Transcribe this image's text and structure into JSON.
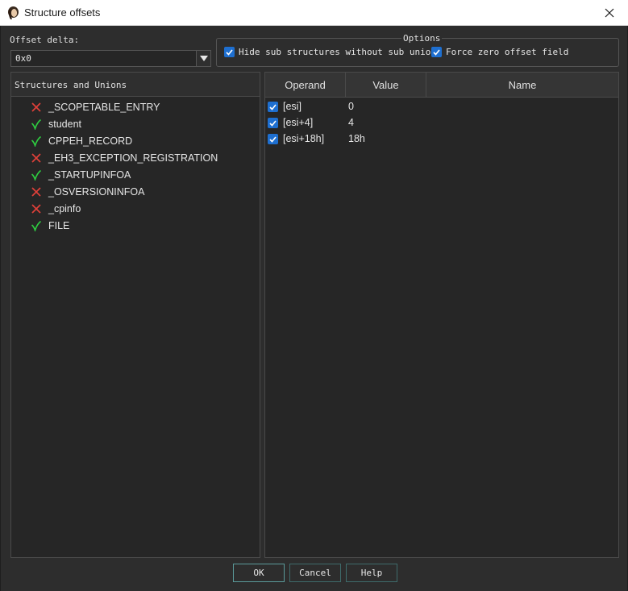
{
  "window": {
    "title": "Structure offsets",
    "icon": "app-icon",
    "close": "close-icon"
  },
  "offset": {
    "label": "Offset delta:",
    "value": "0x0"
  },
  "options": {
    "title": "Options",
    "hide_sub_structures": {
      "label": "Hide sub structures without sub unions",
      "checked": true
    },
    "force_zero_offset": {
      "label": "Force zero offset field",
      "checked": true
    }
  },
  "structures": {
    "header": "Structures and Unions",
    "items": [
      {
        "name": "_SCOPETABLE_ENTRY",
        "status": "invalid"
      },
      {
        "name": "student",
        "status": "valid"
      },
      {
        "name": "CPPEH_RECORD",
        "status": "valid"
      },
      {
        "name": "_EH3_EXCEPTION_REGISTRATION",
        "status": "invalid"
      },
      {
        "name": "_STARTUPINFOA",
        "status": "valid"
      },
      {
        "name": "_OSVERSIONINFOA",
        "status": "invalid"
      },
      {
        "name": "_cpinfo",
        "status": "invalid"
      },
      {
        "name": "FILE",
        "status": "valid"
      }
    ]
  },
  "operands": {
    "columns": [
      "Operand",
      "Value",
      "Name"
    ],
    "rows": [
      {
        "checked": true,
        "operand": "[esi]",
        "value": "0",
        "name": ""
      },
      {
        "checked": true,
        "operand": "[esi+4]",
        "value": "4",
        "name": ""
      },
      {
        "checked": true,
        "operand": "[esi+18h]",
        "value": "18h",
        "name": ""
      }
    ]
  },
  "buttons": {
    "ok": "OK",
    "cancel": "Cancel",
    "help": "Help"
  },
  "colors": {
    "valid": "#2ecc40",
    "invalid": "#e0403a",
    "checkbox": "#1e6fd0",
    "background": "#2d2d2d"
  }
}
